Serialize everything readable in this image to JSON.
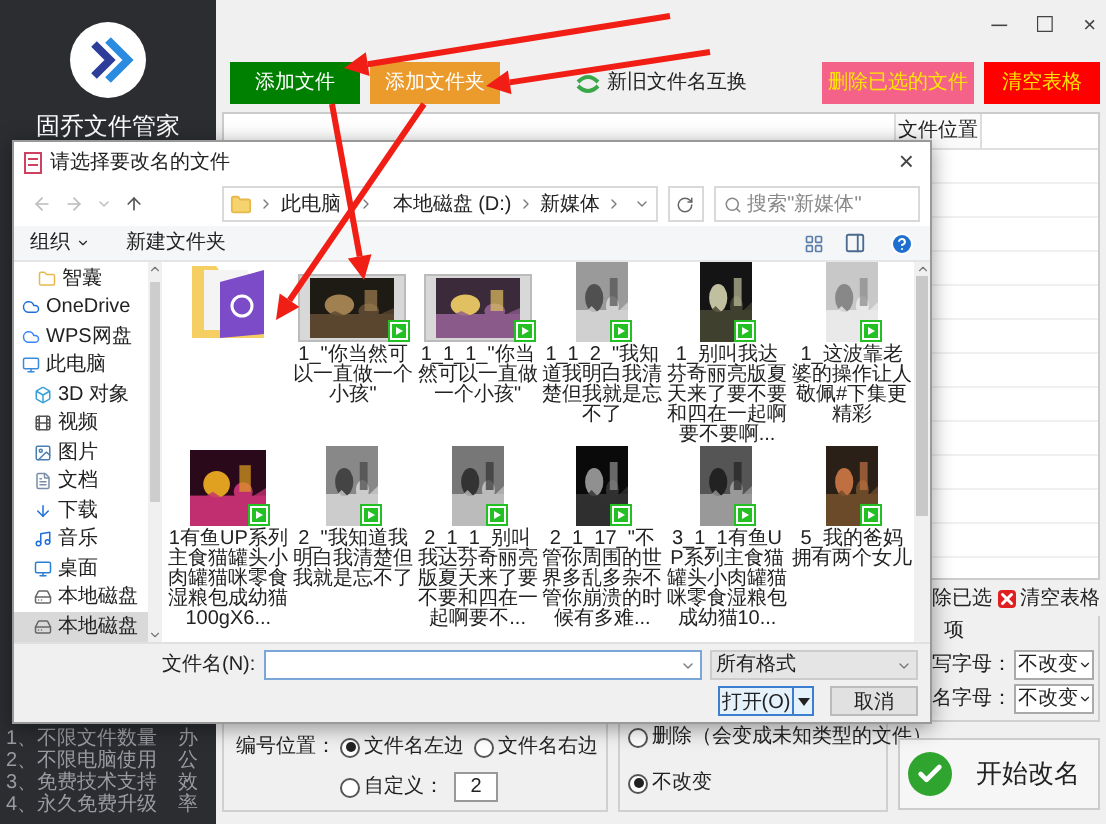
{
  "sidebar": {
    "app_name": "固乔文件管家",
    "features": [
      "1、不限文件数量",
      "2、不限电脑使用",
      "3、免费技术支持",
      "4、永久免费升级"
    ],
    "slogan": "办公效率"
  },
  "window_controls": [
    "─",
    "☐",
    "×"
  ],
  "toolbar": {
    "buttons": [
      {
        "label": "添加文件",
        "kind": "solid",
        "color": "#008000"
      },
      {
        "label": "添加文件夹",
        "kind": "solid",
        "color": "#eb9b2c"
      },
      {
        "label": "新旧文件名互换",
        "kind": "plain"
      },
      {
        "label": "删除已选的文件",
        "kind": "solid",
        "color": "#f4628a"
      },
      {
        "label": "清空表格",
        "kind": "solid",
        "color": "#ff0000"
      }
    ]
  },
  "table": {
    "columns": [
      "文件位置"
    ]
  },
  "table_actions": [
    {
      "label": "除已选",
      "kind": "plain"
    },
    {
      "label": "清空表格",
      "kind": "clear"
    }
  ],
  "numbering": {
    "position_label": "编号位置：",
    "options": [
      {
        "label": "文件名左边",
        "selected": true
      },
      {
        "label": "文件名右边",
        "selected": false
      },
      {
        "label": "自定义：",
        "selected": false
      }
    ],
    "custom_value": "2"
  },
  "extension": {
    "options": [
      {
        "label": "删除（会变成未知类型的文件）",
        "selected": false
      },
      {
        "label": "不改变",
        "selected": true
      }
    ]
  },
  "case_options": {
    "title": "项",
    "rows": [
      {
        "label": "写字母：",
        "value": "不改变"
      },
      {
        "label": "名字母：",
        "value": "不改变"
      }
    ]
  },
  "start_button": "开始改名",
  "dialog": {
    "title": "请选择要改名的文件",
    "close": "×",
    "path": [
      "此电脑",
      "本地磁盘 (D:)",
      "新媒体"
    ],
    "search_placeholder": "搜索\"新媒体\"",
    "toolbar": [
      {
        "label": "组织",
        "kind": "menu"
      },
      {
        "label": "新建文件夹",
        "kind": "plain"
      }
    ],
    "nav": [
      {
        "label": "智囊",
        "kind": "folder",
        "selected": false
      },
      {
        "label": "OneDrive",
        "kind": "cloud",
        "selected": false
      },
      {
        "label": "WPS网盘",
        "kind": "cloud2",
        "selected": false
      },
      {
        "label": "此电脑",
        "kind": "computer",
        "selected": false
      },
      {
        "label": "3D 对象",
        "kind": "objects",
        "selected": false
      },
      {
        "label": "视频",
        "kind": "videos",
        "selected": false
      },
      {
        "label": "图片",
        "kind": "pictures",
        "selected": false
      },
      {
        "label": "文档",
        "kind": "documents",
        "selected": false
      },
      {
        "label": "下载",
        "kind": "downloads",
        "selected": false
      },
      {
        "label": "音乐",
        "kind": "music",
        "selected": false
      },
      {
        "label": "桌面",
        "kind": "desktop",
        "selected": false
      },
      {
        "label": "本地磁盘",
        "kind": "drive",
        "selected": false
      },
      {
        "label": "本地磁盘",
        "kind": "drive",
        "selected": true
      }
    ],
    "files": [
      {
        "kind": "folder"
      },
      {
        "name": "1_\"你当然可以一直做一个小孩\"",
        "kind": "video_wide"
      },
      {
        "name": "1_1_1_\"你当然可以一直做一个小孩\"",
        "kind": "video_wide"
      },
      {
        "name": "1_1_2_\"我知道我明白我清楚但我就是忘不了",
        "kind": "video_tall"
      },
      {
        "name": "1_别叫我达芬奇丽亮版夏天来了要不要和四在一起啊要不要啊...",
        "kind": "video_tall"
      },
      {
        "name": "1_这波靠老婆的操作让人敬佩#下集更精彩",
        "kind": "video_tall"
      },
      {
        "name": "1有鱼UP系列主食猫罐头小肉罐猫咪零食湿粮包成幼猫100gX6...",
        "kind": "video_square"
      },
      {
        "name": "2_\"我知道我明白我清楚但我就是忘不了",
        "kind": "video_tall"
      },
      {
        "name": "2_1_1_别叫我达芬奇丽亮版夏天来了要不要和四在一起啊要不...",
        "kind": "video_tall"
      },
      {
        "name": "2_1_17_\"不管你周围的世界多乱多杂不管你崩溃的时候有多难...",
        "kind": "video_tall"
      },
      {
        "name": "3_1_1有鱼UP系列主食猫罐头小肉罐猫咪零食湿粮包成幼猫10...",
        "kind": "video_tall"
      },
      {
        "name": "5_我的爸妈拥有两个女儿",
        "kind": "video_tall"
      }
    ],
    "file_name_label": "文件名(N):",
    "filter": "所有格式",
    "open_button": "打开(O)",
    "cancel_button": "取消"
  }
}
